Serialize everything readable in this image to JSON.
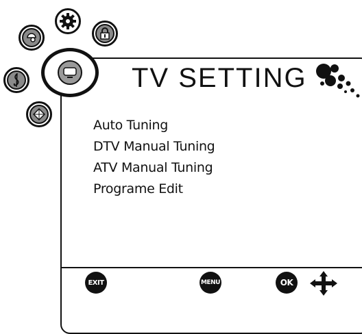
{
  "header": {
    "title": "TV SETTING"
  },
  "menu": {
    "items": [
      {
        "label": "Auto Tuning"
      },
      {
        "label": "DTV Manual Tuning"
      },
      {
        "label": "ATV Manual Tuning"
      },
      {
        "label": "Programe Edit"
      }
    ]
  },
  "footer": {
    "exit_label": "EXIT",
    "menu_label": "MENU",
    "ok_label": "OK"
  },
  "categories": [
    {
      "icon": "picture-icon"
    },
    {
      "icon": "gear-icon"
    },
    {
      "icon": "lock-icon"
    },
    {
      "icon": "music-icon"
    },
    {
      "icon": "tv-icon"
    },
    {
      "icon": "channel-icon"
    }
  ],
  "colors": {
    "foreground": "#111111",
    "icon_fill": "#8a8a8a",
    "background": "#ffffff"
  }
}
